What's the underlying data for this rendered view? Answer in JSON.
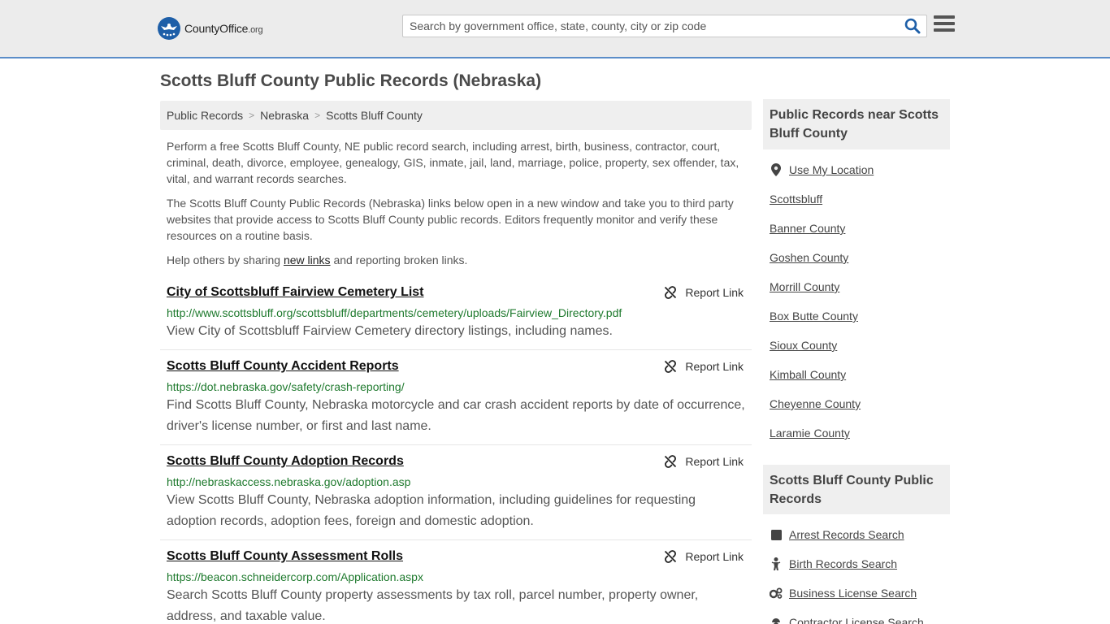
{
  "header": {
    "logo_text": "CountyOffice",
    "logo_tld": ".org",
    "search_placeholder": "Search by government office, state, county, city or zip code"
  },
  "page": {
    "title": "Scotts Bluff County Public Records (Nebraska)"
  },
  "breadcrumb": [
    "Public Records",
    "Nebraska",
    "Scotts Bluff County"
  ],
  "intro": {
    "p1": "Perform a free Scotts Bluff County, NE public record search, including arrest, birth, business, contractor, court, criminal, death, divorce, employee, genealogy, GIS, inmate, jail, land, marriage, police, property, sex offender, tax, vital, and warrant records searches.",
    "p2": "The Scotts Bluff County Public Records (Nebraska) links below open in a new window and take you to third party websites that provide access to Scotts Bluff County public records. Editors frequently monitor and verify these resources on a routine basis.",
    "p3_before": "Help others by sharing ",
    "p3_link": "new links",
    "p3_after": " and reporting broken links."
  },
  "report_label": "Report Link",
  "records": [
    {
      "title": "City of Scottsbluff Fairview Cemetery List",
      "url": "http://www.scottsbluff.org/scottsbluff/departments/cemetery/uploads/Fairview_Directory.pdf",
      "desc": "View City of Scottsbluff Fairview Cemetery directory listings, including names."
    },
    {
      "title": "Scotts Bluff County Accident Reports",
      "url": "https://dot.nebraska.gov/safety/crash-reporting/",
      "desc": "Find Scotts Bluff County, Nebraska motorcycle and car crash accident reports by date of occurrence, driver's license number, or first and last name."
    },
    {
      "title": "Scotts Bluff County Adoption Records",
      "url": "http://nebraskaccess.nebraska.gov/adoption.asp",
      "desc": "View Scotts Bluff County, Nebraska adoption information, including guidelines for requesting adoption records, adoption fees, foreign and domestic adoption."
    },
    {
      "title": "Scotts Bluff County Assessment Rolls",
      "url": "https://beacon.schneidercorp.com/Application.aspx",
      "desc": "Search Scotts Bluff County property assessments by tax roll, parcel number, property owner, address, and taxable value."
    }
  ],
  "sidebar": {
    "near_title": "Public Records near Scotts Bluff County",
    "use_location": "Use My Location",
    "near_links": [
      "Scottsbluff",
      "Banner County",
      "Goshen County",
      "Morrill County",
      "Box Butte County",
      "Sioux County",
      "Kimball County",
      "Cheyenne County",
      "Laramie County"
    ],
    "records_title": "Scotts Bluff County Public Records",
    "record_links": [
      {
        "label": "Arrest Records Search",
        "icon": "square-icon"
      },
      {
        "label": "Birth Records Search",
        "icon": "baby-icon"
      },
      {
        "label": "Business License Search",
        "icon": "gears-icon"
      },
      {
        "label": "Contractor License Search",
        "icon": "contractor-icon"
      }
    ]
  }
}
